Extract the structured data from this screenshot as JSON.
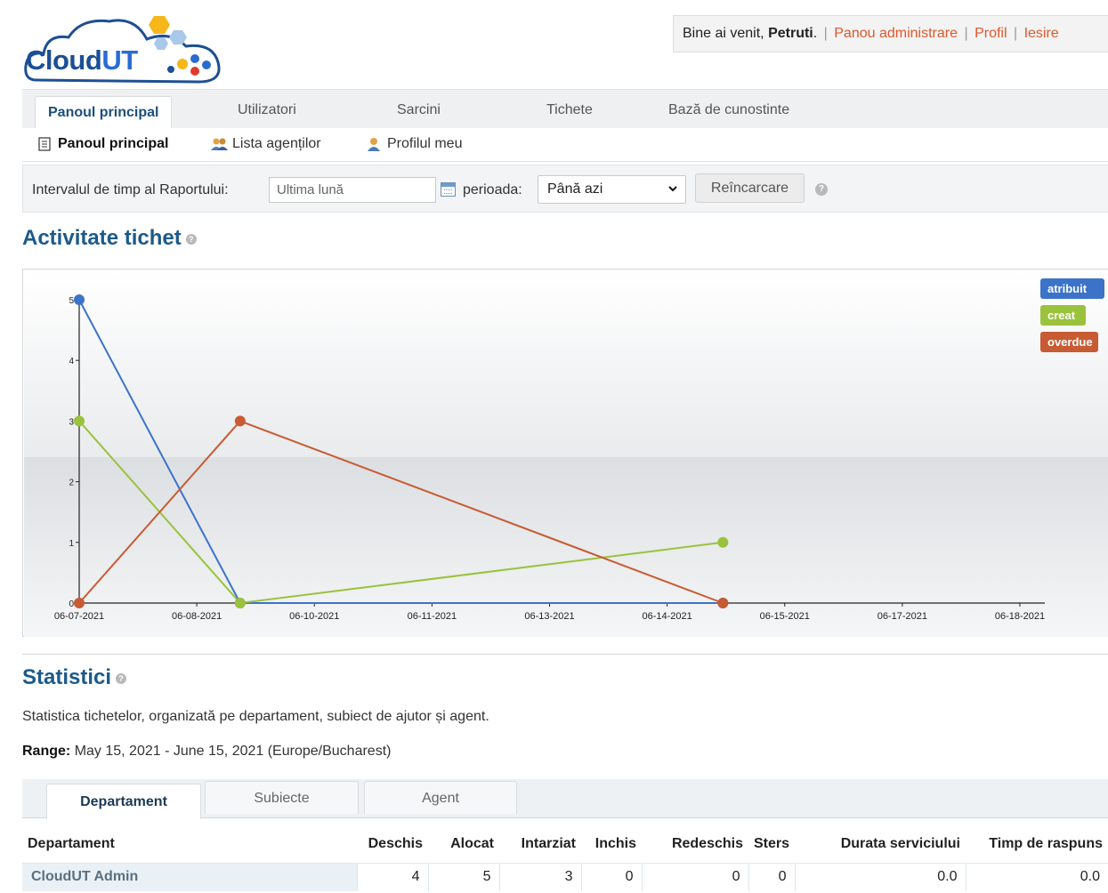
{
  "header": {
    "logo_text": "Cloud",
    "logo_text_accent": "UT",
    "welcome_prefix": "Bine ai venit,",
    "user_name": "Petruti",
    "welcome_suffix": ".",
    "links": [
      "Panou administrare",
      "Profil",
      "Iesire"
    ]
  },
  "nav": {
    "tabs": [
      "Panoul principal",
      "Utilizatori",
      "Sarcini",
      "Tichete",
      "Bază de cunostinte"
    ],
    "active": 0
  },
  "subnav": {
    "items": [
      {
        "label": "Panoul principal",
        "icon": "document-icon"
      },
      {
        "label": "Lista agenților",
        "icon": "users-icon"
      },
      {
        "label": "Profilul meu",
        "icon": "user-icon"
      }
    ]
  },
  "filter": {
    "interval_label": "Intervalul de timp al Raportului:",
    "interval_value": "Ultima lună",
    "period_label": "perioada:",
    "period_selected": "Până azi",
    "reload_label": "Reîncarcare"
  },
  "activity": {
    "title": "Activitate tichet"
  },
  "chart_data": {
    "type": "line",
    "title": "",
    "xlabel": "",
    "ylabel": "",
    "x_ticks": [
      "06-07-2021",
      "06-08-2021",
      "06-10-2021",
      "06-11-2021",
      "06-13-2021",
      "06-14-2021",
      "06-15-2021",
      "06-17-2021",
      "06-18-2021"
    ],
    "y_ticks": [
      0,
      1,
      2,
      3,
      4,
      5
    ],
    "ylim": [
      0,
      5
    ],
    "x_range": [
      "2021-06-07",
      "2021-06-18"
    ],
    "legend_position": "top-right",
    "series": [
      {
        "name": "atribuit",
        "color": "#3b73c9",
        "points": [
          {
            "x": "2021-06-07",
            "y": 5
          },
          {
            "x": "2021-06-09",
            "y": 0
          },
          {
            "x": "2021-06-15",
            "y": 0
          }
        ]
      },
      {
        "name": "creat",
        "color": "#9ac23c",
        "points": [
          {
            "x": "2021-06-07",
            "y": 3
          },
          {
            "x": "2021-06-09",
            "y": 0
          },
          {
            "x": "2021-06-15",
            "y": 1
          }
        ]
      },
      {
        "name": "overdue",
        "color": "#c75b33",
        "points": [
          {
            "x": "2021-06-07",
            "y": 0
          },
          {
            "x": "2021-06-09",
            "y": 3
          },
          {
            "x": "2021-06-15",
            "y": 0
          }
        ]
      }
    ]
  },
  "statistics": {
    "title": "Statistici",
    "description": "Statistica tichetelor, organizată pe departament, subiect de ajutor și agent.",
    "range_label": "Range:",
    "range_value": "May 15, 2021 - June 15, 2021 (Europe/Bucharest)",
    "tabs": [
      "Departament",
      "Subiecte",
      "Agent"
    ],
    "active_tab": 0,
    "columns": [
      "Departament",
      "Deschis",
      "Alocat",
      "Intarziat",
      "Inchis",
      "Redeschis",
      "Sters",
      "Durata serviciului",
      "Timp de raspuns"
    ],
    "rows": [
      [
        "CloudUT Admin",
        "4",
        "5",
        "3",
        "0",
        "0",
        "0",
        "0.0",
        "0.0"
      ]
    ]
  },
  "colors": {
    "accent": "#1c5a8a",
    "link": "#e0572a"
  }
}
